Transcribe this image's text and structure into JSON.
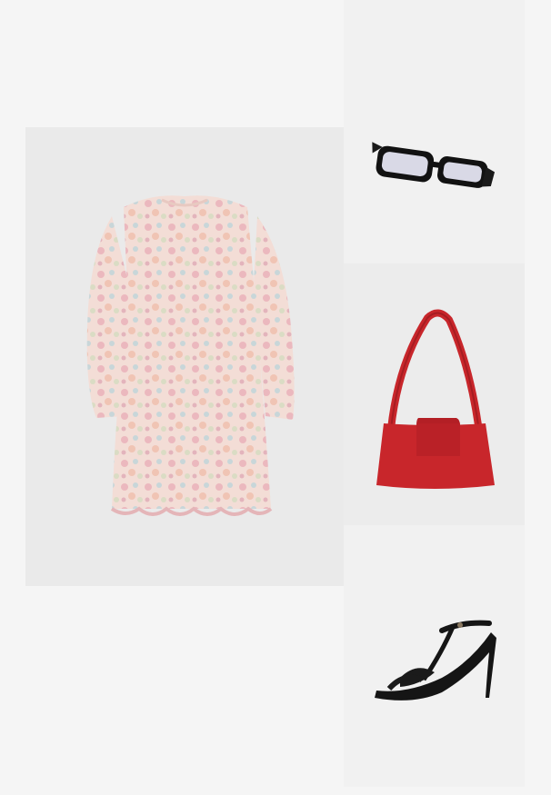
{
  "board": {
    "items": [
      {
        "id": "dress",
        "kind": "product-image",
        "color": "#f2d8d2"
      },
      {
        "id": "glasses",
        "kind": "product-image",
        "color": "#111111"
      },
      {
        "id": "bag",
        "kind": "product-image",
        "color": "#c8262b"
      },
      {
        "id": "shoe",
        "kind": "product-image",
        "color": "#151515"
      }
    ]
  },
  "colors": {
    "page_background": "#f5f5f5",
    "tile_background": "#ececec"
  }
}
